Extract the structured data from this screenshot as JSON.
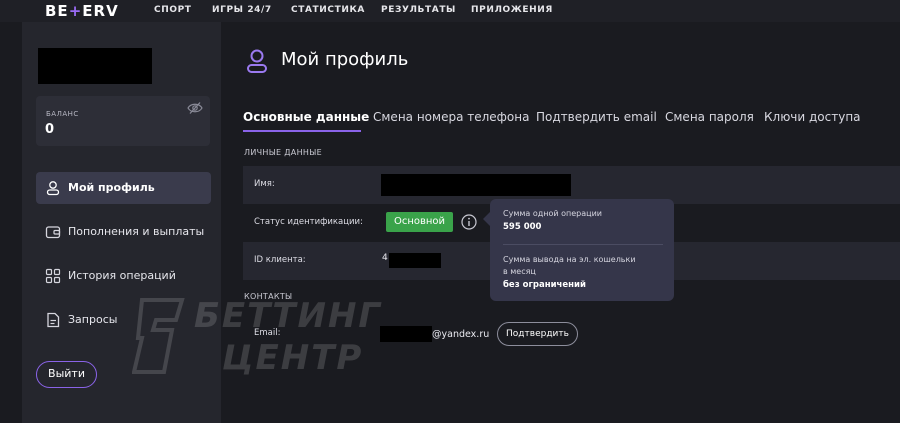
{
  "header": {
    "logo_left": "BE",
    "logo_plus": "+",
    "logo_right": "ERV",
    "nav": [
      "СПОРТ",
      "ИГРЫ 24/7",
      "СТАТИСТИКА",
      "РЕЗУЛЬТАТЫ",
      "ПРИЛОЖЕНИЯ"
    ]
  },
  "sidebar": {
    "balance_label": "БАЛАНС",
    "balance_value": "0",
    "menu": [
      {
        "label": "Мой профиль",
        "icon": "user-icon",
        "active": true
      },
      {
        "label": "Пополнения и выплаты",
        "icon": "wallet-icon",
        "active": false
      },
      {
        "label": "История операций",
        "icon": "grid-icon",
        "active": false
      },
      {
        "label": "Запросы",
        "icon": "document-icon",
        "active": false
      }
    ],
    "logout_label": "Выйти"
  },
  "main": {
    "title": "Мой профиль",
    "tabs": [
      {
        "label": "Основные данные",
        "active": true
      },
      {
        "label": "Смена номера телефона",
        "active": false
      },
      {
        "label": "Подтвердить email",
        "active": false
      },
      {
        "label": "Смена пароля",
        "active": false
      },
      {
        "label": "Ключи доступа",
        "active": false
      }
    ],
    "personal_section": "ЛИЧНЫЕ ДАННЫЕ",
    "name_label": "Имя:",
    "status_label": "Статус идентификации:",
    "status_value": "Основной",
    "client_id_label": "ID клиента:",
    "client_id_prefix": "4",
    "contacts_section": "КОНТАКТЫ",
    "email_label": "Email:",
    "email_domain": "@yandex.ru",
    "confirm_label": "Подтвердить"
  },
  "tooltip": {
    "line1": "Сумма одной операции",
    "value1": "595 000",
    "line2a": "Сумма вывода на эл. кошельки",
    "line2b": "в месяц",
    "value2": "без ограничений"
  },
  "watermark": {
    "line1": "БЕТТИНГ",
    "line2": "ЦЕНТР"
  },
  "colors": {
    "accent": "#8a63e8",
    "status_green": "#3aa34a",
    "background": "#1a1b20",
    "sidebar": "#25262d"
  }
}
